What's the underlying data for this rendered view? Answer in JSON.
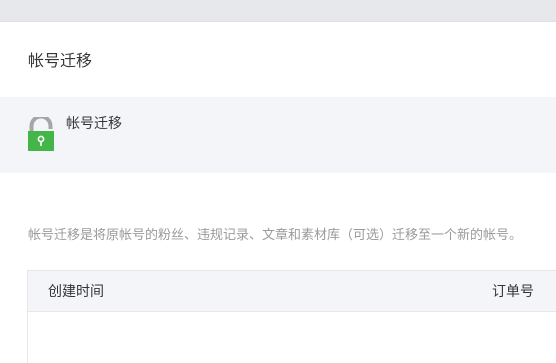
{
  "header": {
    "title": "帐号迁移"
  },
  "info": {
    "title": "帐号迁移",
    "icon": "unlock-icon",
    "icon_colors": {
      "shackle": "#a6a6a6",
      "body": "#44b549",
      "keyhole": "#ffffff"
    }
  },
  "description": "帐号迁移是将原帐号的粉丝、违规记录、文章和素材库（可选）迁移至一个新的帐号。",
  "table": {
    "columns": [
      "创建时间",
      "订单号"
    ],
    "rows": []
  }
}
